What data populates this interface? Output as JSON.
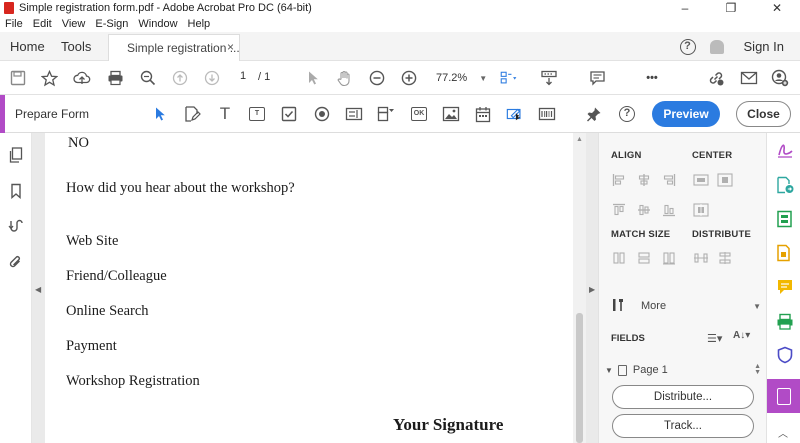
{
  "window": {
    "title": "Simple registration form.pdf - Adobe Acrobat Pro DC (64-bit)",
    "controls": [
      "–",
      "❐",
      "✕"
    ]
  },
  "menu": [
    "File",
    "Edit",
    "View",
    "E-Sign",
    "Window",
    "Help"
  ],
  "tabs": {
    "home": "Home",
    "tools": "Tools",
    "document": "Simple registration ...",
    "close": "×"
  },
  "header": {
    "help": "?",
    "sign_in": "Sign In"
  },
  "toolbar": {
    "page_current": "1",
    "page_total": "/ 1",
    "zoom": "77.2%",
    "more": "•••"
  },
  "form_toolbar": {
    "title": "Prepare Form",
    "ok_label": "OK",
    "help": "?",
    "preview": "Preview",
    "close": "Close"
  },
  "document": {
    "lines": [
      "NO",
      "How did you hear about the workshop?",
      "Web Site",
      "Friend/Colleague",
      "Online Search",
      "Payment",
      "Workshop Registration"
    ],
    "signature": "Your Signature"
  },
  "right_panel": {
    "align": "ALIGN",
    "center": "CENTER",
    "match_size": "MATCH SIZE",
    "distribute": "DISTRIBUTE",
    "more": "More",
    "fields": "FIELDS",
    "page": "Page 1",
    "distribute_button": "Distribute...",
    "track_button": "Track..."
  },
  "colors": {
    "accent": "#b14bc6",
    "primary_button": "#2b7be0"
  }
}
